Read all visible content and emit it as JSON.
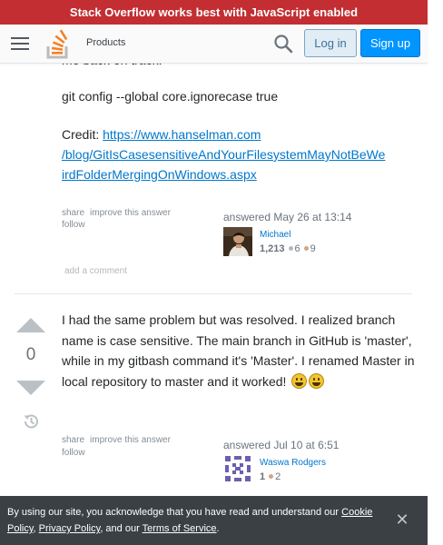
{
  "notice": {
    "text": "Stack Overflow works best with JavaScript enabled"
  },
  "header": {
    "menu_icon": "hamburger-icon",
    "logo_icon": "stackoverflow-logo",
    "products_label": "Products",
    "search_icon": "search-icon",
    "login_label": "Log in",
    "signup_label": "Sign up"
  },
  "answer1": {
    "cut_text": "me back on track.",
    "command": "git config --global core.ignorecase true",
    "credit_prefix": "Credit: ",
    "credit_link": "https://www.hanselman.com/blog/GitIsCasesensitiveAndYourFilesystemMayNotBeWeirdFolderMergingOnWindows.aspx",
    "credit_link_lines": [
      "https://www.hanselman.com",
      "/blog/GitIsCasesensitiveAndYourFilesystemMayNotBeWe",
      "irdFolderMergingOnWindows.aspx"
    ],
    "menu": {
      "share": "share",
      "improve": "improve this answer",
      "follow": "follow"
    },
    "answered": "answered May 26 at 13:14",
    "user": {
      "name": "Michael",
      "rep": "1,213",
      "silver": "6",
      "bronze": "9"
    },
    "add_comment": "add a comment"
  },
  "answer2": {
    "votes": "0",
    "history_icon": "history-icon",
    "body": "I had the same problem but was resolved. I realized branch name is case sensitive. The main branch in GitHub is 'master', while in my gitbash command it's 'Master'. I renamed Master in local repository to master and it worked!",
    "emoji_icon": "grinning-face-emoji",
    "menu": {
      "share": "share",
      "improve": "improve this answer",
      "follow": "follow"
    },
    "answered": "answered Jul 10 at 6:51",
    "user": {
      "name": "Waswa Rodgers",
      "rep": "1",
      "bronze": "2"
    }
  },
  "cookie": {
    "text_before": "By using our site, you acknowledge that you have read and understand our ",
    "cookie_policy": "Cookie Policy",
    "sep1": ", ",
    "privacy_policy": "Privacy Policy",
    "sep2": ", and our ",
    "terms": "Terms of Service",
    "text_after": ".",
    "close_icon": "close-icon"
  },
  "colors": {
    "notice_bg": "#c22e32",
    "link": "#0077cc",
    "signup_bg": "#0095ff",
    "login_bg": "#e1ecf4",
    "cookie_bg": "#3b4045"
  }
}
